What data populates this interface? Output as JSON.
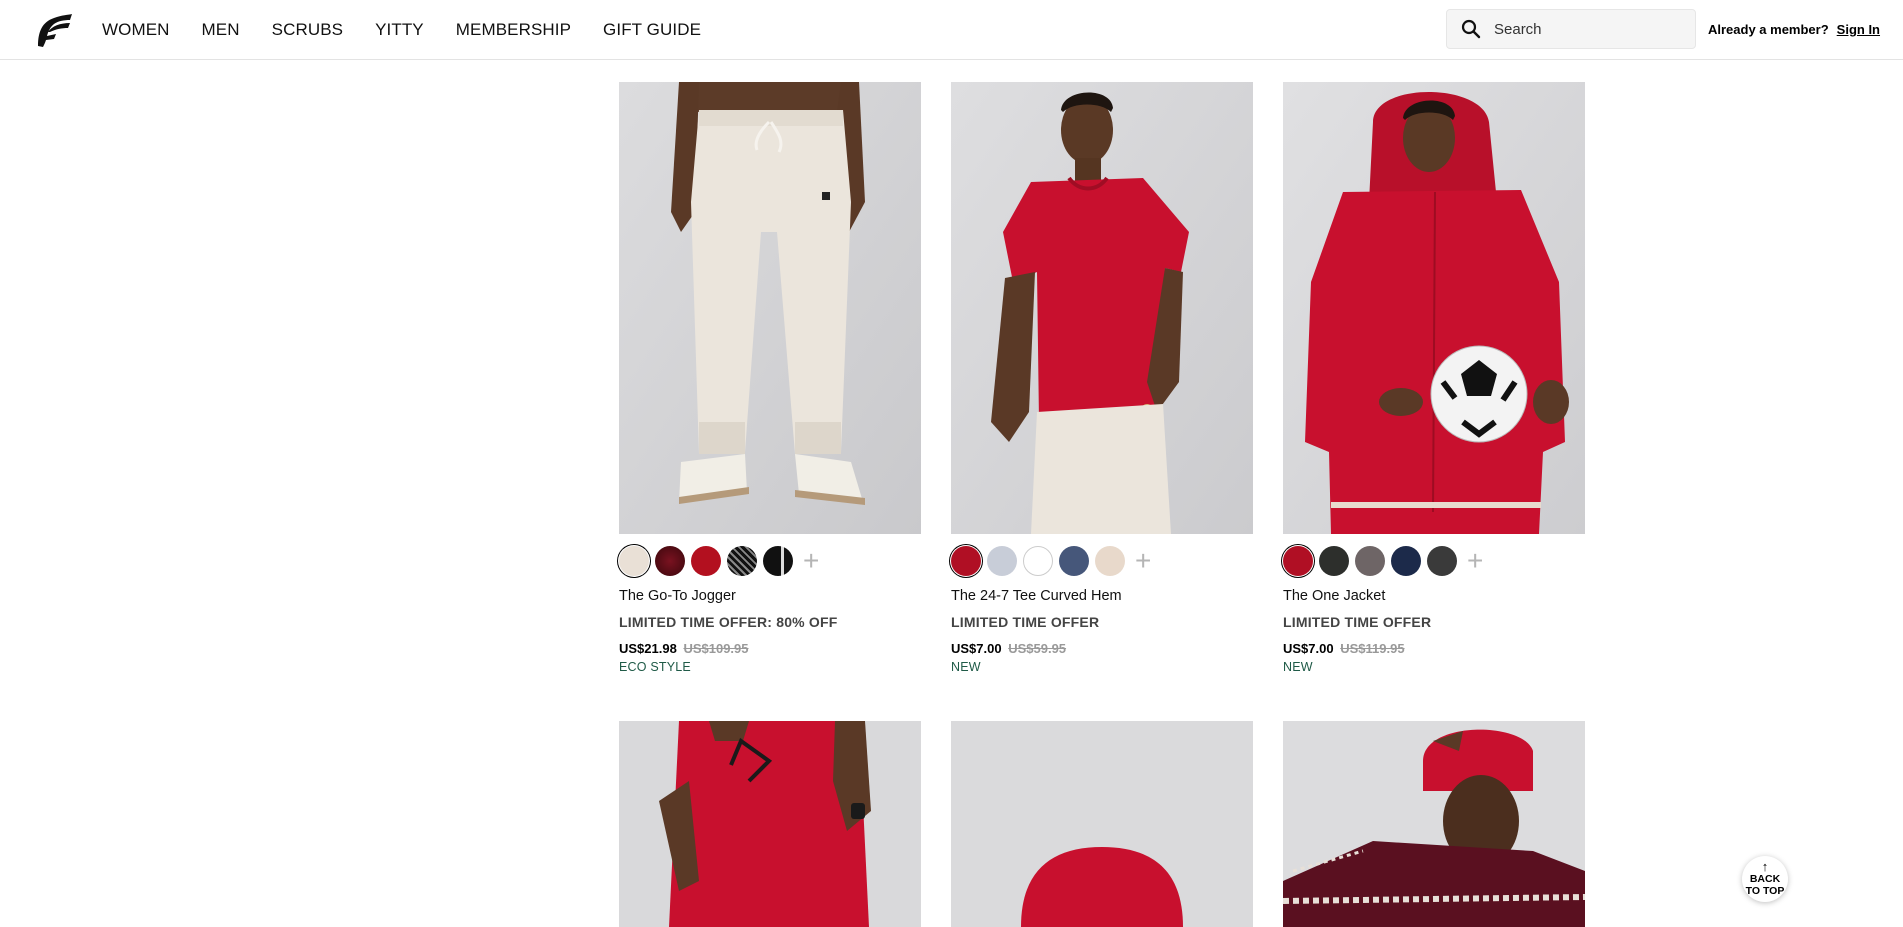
{
  "header": {
    "logo_name": "fabletics-logo",
    "nav": [
      "WOMEN",
      "MEN",
      "SCRUBS",
      "YITTY",
      "MEMBERSHIP",
      "GIFT GUIDE"
    ],
    "search_placeholder": "Search",
    "member_text": "Already a member?",
    "signin_label": "Sign In"
  },
  "products": [
    {
      "name": "The Go-To Jogger",
      "promo": "LIMITED TIME OFFER: 80% OFF",
      "price": "US$21.98",
      "original_price": "US$109.95",
      "tag": "ECO STYLE",
      "swatches": [
        "#e9e0d6",
        "#5a0f17",
        "#b3101f",
        "#2a2a2a",
        "#111111"
      ]
    },
    {
      "name": "The 24-7 Tee Curved Hem",
      "promo": "LIMITED TIME OFFER",
      "price": "US$7.00",
      "original_price": "US$59.95",
      "tag": "NEW",
      "swatches": [
        "#b00f24",
        "#c8cdd8",
        "#ffffff",
        "#46577a",
        "#e8d9cb"
      ]
    },
    {
      "name": "The One Jacket",
      "promo": "LIMITED TIME OFFER",
      "price": "US$7.00",
      "original_price": "US$119.95",
      "tag": "NEW",
      "swatches": [
        "#b00f24",
        "#2d2f2c",
        "#6e6566",
        "#1c2a4a",
        "#3a3a3a"
      ]
    }
  ],
  "back_to_top": {
    "line1": "BACK",
    "line2": "TO TOP"
  },
  "colors": {
    "accent_tag": "#1f5a47",
    "product_red": "#c1121f"
  }
}
